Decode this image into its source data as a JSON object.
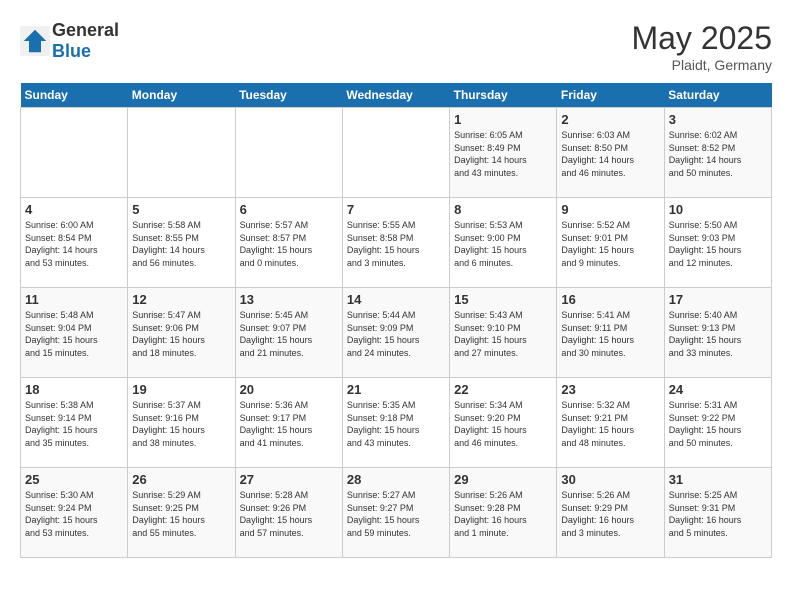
{
  "header": {
    "logo_general": "General",
    "logo_blue": "Blue",
    "month_year": "May 2025",
    "location": "Plaidt, Germany"
  },
  "days_of_week": [
    "Sunday",
    "Monday",
    "Tuesday",
    "Wednesday",
    "Thursday",
    "Friday",
    "Saturday"
  ],
  "weeks": [
    [
      {
        "day": "",
        "info": ""
      },
      {
        "day": "",
        "info": ""
      },
      {
        "day": "",
        "info": ""
      },
      {
        "day": "",
        "info": ""
      },
      {
        "day": "1",
        "info": "Sunrise: 6:05 AM\nSunset: 8:49 PM\nDaylight: 14 hours\nand 43 minutes."
      },
      {
        "day": "2",
        "info": "Sunrise: 6:03 AM\nSunset: 8:50 PM\nDaylight: 14 hours\nand 46 minutes."
      },
      {
        "day": "3",
        "info": "Sunrise: 6:02 AM\nSunset: 8:52 PM\nDaylight: 14 hours\nand 50 minutes."
      }
    ],
    [
      {
        "day": "4",
        "info": "Sunrise: 6:00 AM\nSunset: 8:54 PM\nDaylight: 14 hours\nand 53 minutes."
      },
      {
        "day": "5",
        "info": "Sunrise: 5:58 AM\nSunset: 8:55 PM\nDaylight: 14 hours\nand 56 minutes."
      },
      {
        "day": "6",
        "info": "Sunrise: 5:57 AM\nSunset: 8:57 PM\nDaylight: 15 hours\nand 0 minutes."
      },
      {
        "day": "7",
        "info": "Sunrise: 5:55 AM\nSunset: 8:58 PM\nDaylight: 15 hours\nand 3 minutes."
      },
      {
        "day": "8",
        "info": "Sunrise: 5:53 AM\nSunset: 9:00 PM\nDaylight: 15 hours\nand 6 minutes."
      },
      {
        "day": "9",
        "info": "Sunrise: 5:52 AM\nSunset: 9:01 PM\nDaylight: 15 hours\nand 9 minutes."
      },
      {
        "day": "10",
        "info": "Sunrise: 5:50 AM\nSunset: 9:03 PM\nDaylight: 15 hours\nand 12 minutes."
      }
    ],
    [
      {
        "day": "11",
        "info": "Sunrise: 5:48 AM\nSunset: 9:04 PM\nDaylight: 15 hours\nand 15 minutes."
      },
      {
        "day": "12",
        "info": "Sunrise: 5:47 AM\nSunset: 9:06 PM\nDaylight: 15 hours\nand 18 minutes."
      },
      {
        "day": "13",
        "info": "Sunrise: 5:45 AM\nSunset: 9:07 PM\nDaylight: 15 hours\nand 21 minutes."
      },
      {
        "day": "14",
        "info": "Sunrise: 5:44 AM\nSunset: 9:09 PM\nDaylight: 15 hours\nand 24 minutes."
      },
      {
        "day": "15",
        "info": "Sunrise: 5:43 AM\nSunset: 9:10 PM\nDaylight: 15 hours\nand 27 minutes."
      },
      {
        "day": "16",
        "info": "Sunrise: 5:41 AM\nSunset: 9:11 PM\nDaylight: 15 hours\nand 30 minutes."
      },
      {
        "day": "17",
        "info": "Sunrise: 5:40 AM\nSunset: 9:13 PM\nDaylight: 15 hours\nand 33 minutes."
      }
    ],
    [
      {
        "day": "18",
        "info": "Sunrise: 5:38 AM\nSunset: 9:14 PM\nDaylight: 15 hours\nand 35 minutes."
      },
      {
        "day": "19",
        "info": "Sunrise: 5:37 AM\nSunset: 9:16 PM\nDaylight: 15 hours\nand 38 minutes."
      },
      {
        "day": "20",
        "info": "Sunrise: 5:36 AM\nSunset: 9:17 PM\nDaylight: 15 hours\nand 41 minutes."
      },
      {
        "day": "21",
        "info": "Sunrise: 5:35 AM\nSunset: 9:18 PM\nDaylight: 15 hours\nand 43 minutes."
      },
      {
        "day": "22",
        "info": "Sunrise: 5:34 AM\nSunset: 9:20 PM\nDaylight: 15 hours\nand 46 minutes."
      },
      {
        "day": "23",
        "info": "Sunrise: 5:32 AM\nSunset: 9:21 PM\nDaylight: 15 hours\nand 48 minutes."
      },
      {
        "day": "24",
        "info": "Sunrise: 5:31 AM\nSunset: 9:22 PM\nDaylight: 15 hours\nand 50 minutes."
      }
    ],
    [
      {
        "day": "25",
        "info": "Sunrise: 5:30 AM\nSunset: 9:24 PM\nDaylight: 15 hours\nand 53 minutes."
      },
      {
        "day": "26",
        "info": "Sunrise: 5:29 AM\nSunset: 9:25 PM\nDaylight: 15 hours\nand 55 minutes."
      },
      {
        "day": "27",
        "info": "Sunrise: 5:28 AM\nSunset: 9:26 PM\nDaylight: 15 hours\nand 57 minutes."
      },
      {
        "day": "28",
        "info": "Sunrise: 5:27 AM\nSunset: 9:27 PM\nDaylight: 15 hours\nand 59 minutes."
      },
      {
        "day": "29",
        "info": "Sunrise: 5:26 AM\nSunset: 9:28 PM\nDaylight: 16 hours\nand 1 minute."
      },
      {
        "day": "30",
        "info": "Sunrise: 5:26 AM\nSunset: 9:29 PM\nDaylight: 16 hours\nand 3 minutes."
      },
      {
        "day": "31",
        "info": "Sunrise: 5:25 AM\nSunset: 9:31 PM\nDaylight: 16 hours\nand 5 minutes."
      }
    ]
  ]
}
